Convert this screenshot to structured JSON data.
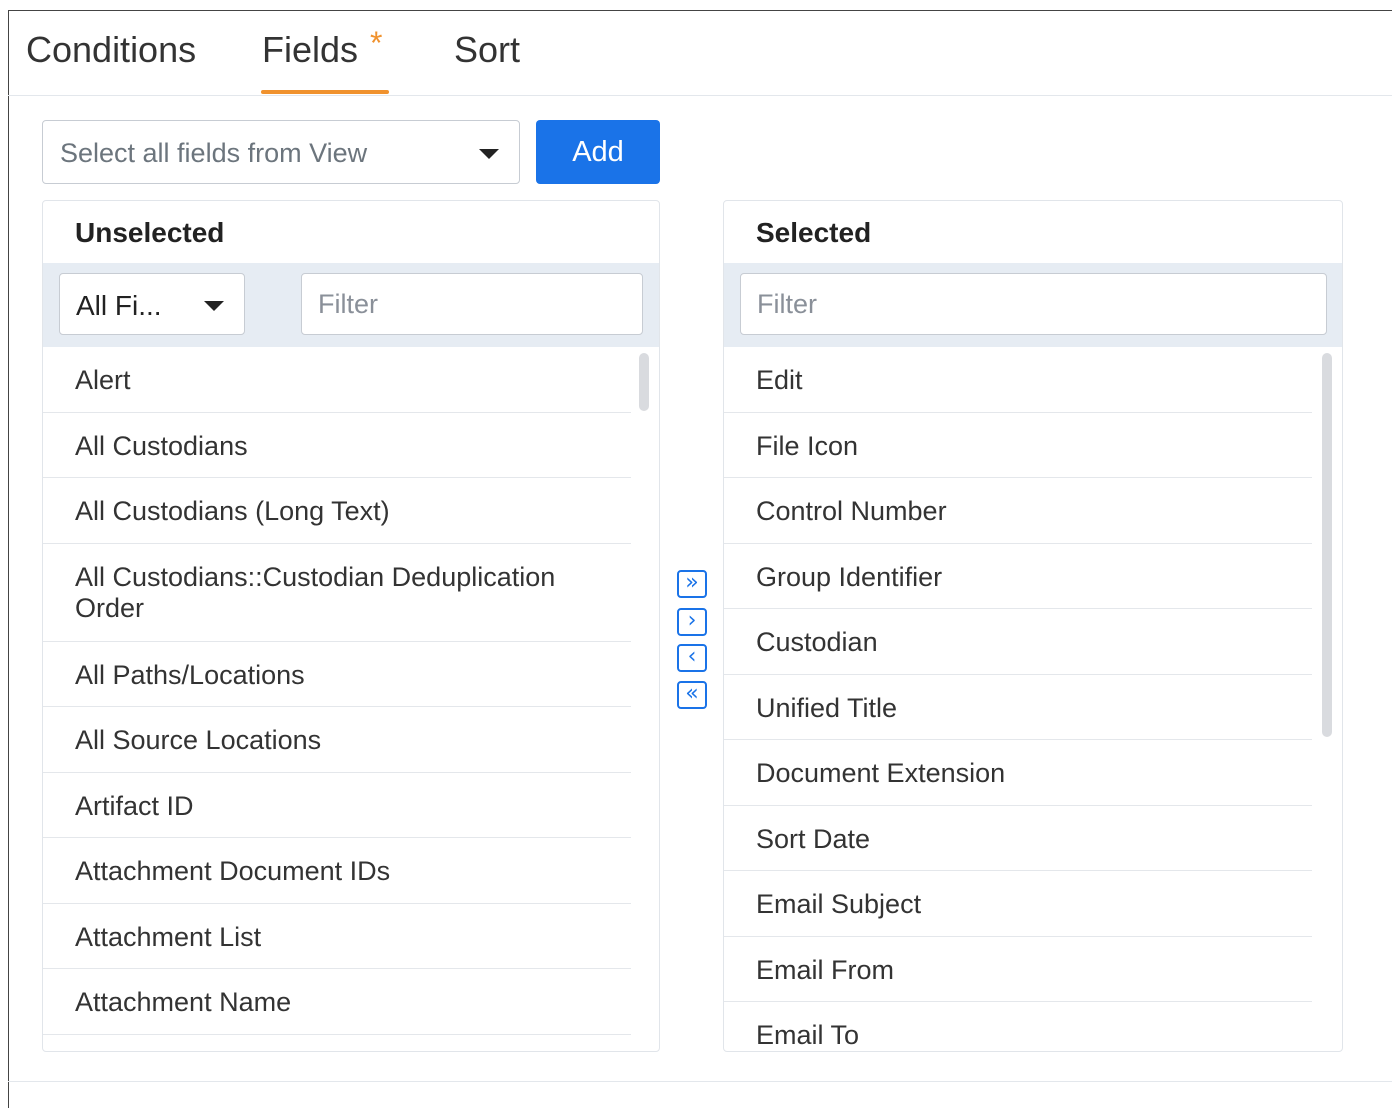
{
  "tabs": {
    "conditions": "Conditions",
    "fields": "Fields",
    "fields_marker": "*",
    "sort": "Sort"
  },
  "view_select": {
    "placeholder": "Select all fields from View"
  },
  "add_button": "Add",
  "unselected": {
    "title": "Unselected",
    "type_filter_value": "All Fi...",
    "filter_placeholder": "Filter",
    "items": [
      "Alert",
      "All Custodians",
      "All Custodians (Long Text)",
      "All Custodians::Custodian Deduplication Order",
      "All Paths/Locations",
      "All Source Locations",
      "Artifact ID",
      "Attachment Document IDs",
      "Attachment List",
      "Attachment Name"
    ]
  },
  "selected": {
    "title": "Selected",
    "filter_placeholder": "Filter",
    "items": [
      "Edit",
      "File Icon",
      "Control Number",
      "Group Identifier",
      "Custodian",
      "Unified Title",
      "Document Extension",
      "Sort Date",
      "Email Subject",
      "Email From",
      "Email To"
    ]
  },
  "move_buttons": {
    "add_all": "»",
    "add_one": "›",
    "remove_one": "‹",
    "remove_all": "«"
  },
  "colors": {
    "accent": "#f0922e",
    "primary": "#1a73e8",
    "filter_bar": "#e6ecf3"
  }
}
